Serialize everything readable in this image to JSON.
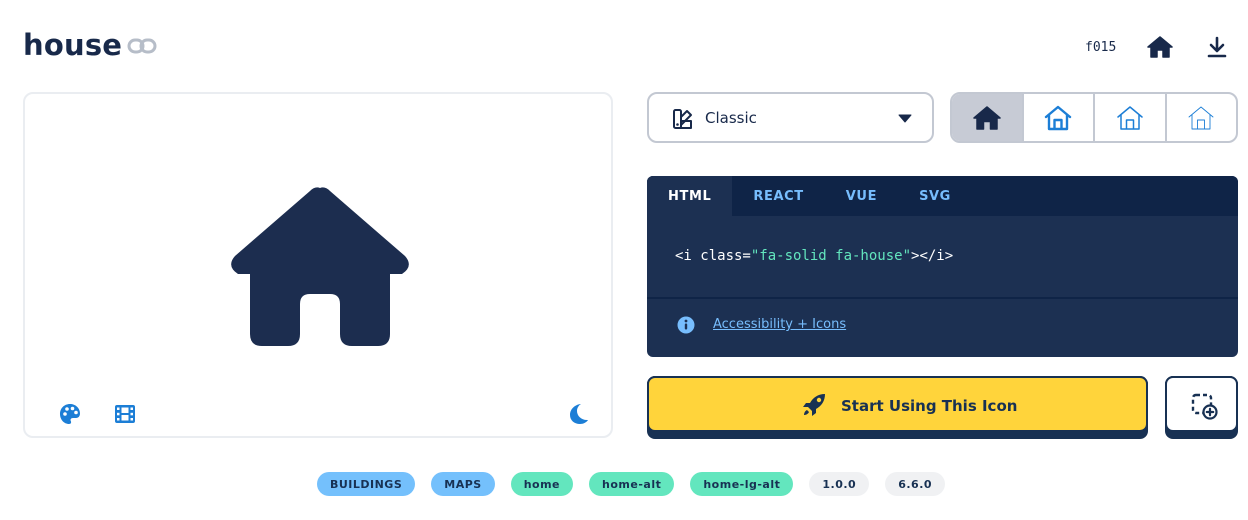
{
  "header": {
    "title": "house",
    "unicode": "f015",
    "icons": [
      "link-icon",
      "house-icon",
      "download-icon"
    ]
  },
  "preview": {
    "icons": [
      "house-icon",
      "palette-icon",
      "film-icon",
      "moon-icon"
    ]
  },
  "family_select": {
    "selected": "Classic",
    "icon": "swatchbook-icon"
  },
  "styles": {
    "options": [
      "solid",
      "regular",
      "light",
      "thin"
    ],
    "active": "solid"
  },
  "code": {
    "tabs": [
      "HTML",
      "REACT",
      "VUE",
      "SVG"
    ],
    "active_tab": "HTML",
    "line_prefix": "<i class=",
    "line_string": "\"fa-solid fa-house\"",
    "line_suffix": "></i>",
    "link": "Accessibility + Icons"
  },
  "cta": {
    "label": "Start Using This Icon"
  },
  "tags": {
    "categories": [
      "BUILDINGS",
      "MAPS"
    ],
    "aliases": [
      "home",
      "home-alt",
      "home-lg-alt"
    ],
    "versions": [
      "1.0.0",
      "6.6.0"
    ]
  },
  "colors": {
    "navy": "#183153",
    "blue": "#1c7ed6",
    "yellow": "#ffd43b",
    "teal": "#63e6be",
    "sky": "#74c0fc"
  }
}
